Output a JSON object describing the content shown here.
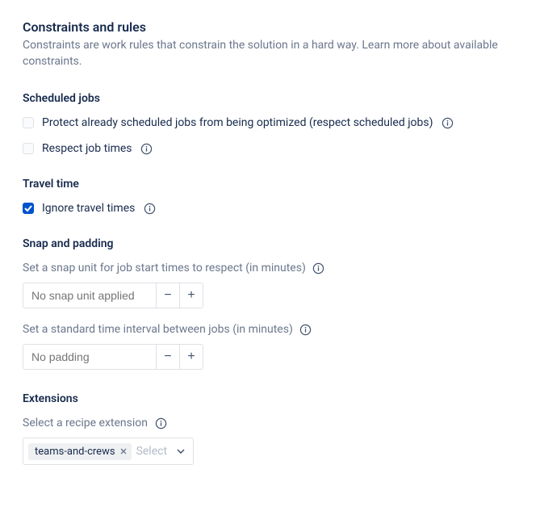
{
  "header": {
    "title": "Constraints and rules",
    "desc": "Constraints are work rules that constrain the solution in a hard way. Learn more about available constraints."
  },
  "scheduled_jobs": {
    "title": "Scheduled jobs",
    "protect": {
      "label": "Protect already scheduled jobs from being optimized (respect scheduled jobs)",
      "checked": false
    },
    "respect": {
      "label": "Respect job times",
      "checked": false
    }
  },
  "travel_time": {
    "title": "Travel time",
    "ignore": {
      "label": "Ignore travel times",
      "checked": true
    }
  },
  "snap_padding": {
    "title": "Snap and padding",
    "snap": {
      "label": "Set a snap unit for job start times to respect (in minutes)",
      "placeholder": "No snap unit applied",
      "value": ""
    },
    "padding": {
      "label": "Set a standard time interval between jobs (in minutes)",
      "placeholder": "No padding",
      "value": ""
    }
  },
  "extensions": {
    "title": "Extensions",
    "label": "Select a recipe extension",
    "chip": "teams-and-crews",
    "placeholder": "Select"
  },
  "symbols": {
    "minus": "−",
    "plus": "+"
  }
}
